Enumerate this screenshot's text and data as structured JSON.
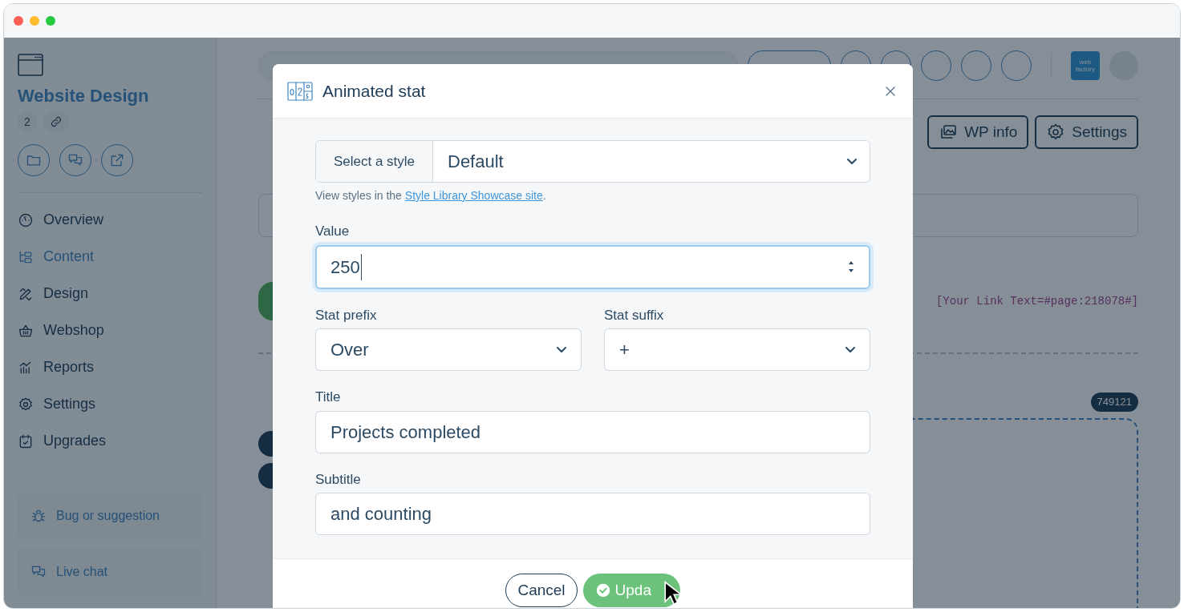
{
  "sidebar": {
    "title": "Website Design",
    "count": "2",
    "items": [
      {
        "label": "Overview",
        "selected": false
      },
      {
        "label": "Content",
        "selected": true
      },
      {
        "label": "Design",
        "selected": false
      },
      {
        "label": "Webshop",
        "selected": false
      },
      {
        "label": "Reports",
        "selected": false
      },
      {
        "label": "Settings",
        "selected": false
      },
      {
        "label": "Upgrades",
        "selected": false
      }
    ],
    "support": [
      "Bug or suggestion",
      "Live chat"
    ]
  },
  "topbar": {
    "logo": "web factory"
  },
  "main": {
    "buttons": [
      "WP info",
      "Settings"
    ],
    "shortcode": "[Your Link Text=#page:218078#]",
    "block_id": "749121"
  },
  "modal": {
    "title": "Animated stat",
    "style_label": "Select a style",
    "style_value": "Default",
    "hint": "View styles in the ",
    "hint_link": "Style Library Showcase site",
    "hint_end": ".",
    "value_label": "Value",
    "value": "250",
    "prefix_label": "Stat prefix",
    "prefix": "Over",
    "suffix_label": "Stat suffix",
    "suffix": "+",
    "title_label": "Title",
    "title_value": "Projects completed",
    "subtitle_label": "Subtitle",
    "subtitle_value": "and counting",
    "cancel": "Cancel",
    "update": "Upda"
  }
}
